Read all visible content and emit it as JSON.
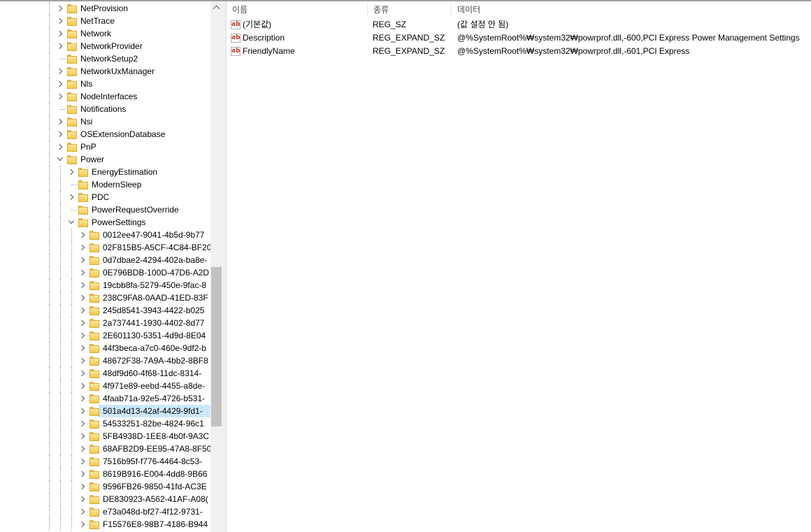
{
  "tree": {
    "items": [
      {
        "label": "NetProvision",
        "expander": "collapsed",
        "level": 0
      },
      {
        "label": "NetTrace",
        "expander": "collapsed",
        "level": 0
      },
      {
        "label": "Network",
        "expander": "collapsed",
        "level": 0
      },
      {
        "label": "NetworkProvider",
        "expander": "collapsed",
        "level": 0
      },
      {
        "label": "NetworkSetup2",
        "expander": "none",
        "level": 0
      },
      {
        "label": "NetworkUxManager",
        "expander": "collapsed",
        "level": 0
      },
      {
        "label": "Nls",
        "expander": "collapsed",
        "level": 0
      },
      {
        "label": "NodeInterfaces",
        "expander": "collapsed",
        "level": 0
      },
      {
        "label": "Notifications",
        "expander": "none",
        "level": 0
      },
      {
        "label": "Nsi",
        "expander": "collapsed",
        "level": 0
      },
      {
        "label": "OSExtensionDatabase",
        "expander": "collapsed",
        "level": 0
      },
      {
        "label": "PnP",
        "expander": "collapsed",
        "level": 0
      },
      {
        "label": "Power",
        "expander": "expanded",
        "level": 0
      },
      {
        "label": "EnergyEstimation",
        "expander": "collapsed",
        "level": 1
      },
      {
        "label": "ModernSleep",
        "expander": "none",
        "level": 1
      },
      {
        "label": "PDC",
        "expander": "collapsed",
        "level": 1
      },
      {
        "label": "PowerRequestOverride",
        "expander": "none",
        "level": 1
      },
      {
        "label": "PowerSettings",
        "expander": "expanded",
        "level": 1
      },
      {
        "label": "0012ee47-9041-4b5d-9b77",
        "expander": "collapsed",
        "level": 2
      },
      {
        "label": "02F815B5-A5CF-4C84-BF20",
        "expander": "collapsed",
        "level": 2
      },
      {
        "label": "0d7dbae2-4294-402a-ba8e-",
        "expander": "collapsed",
        "level": 2
      },
      {
        "label": "0E796BDB-100D-47D6-A2D",
        "expander": "collapsed",
        "level": 2
      },
      {
        "label": "19cbb8fa-5279-450e-9fac-8",
        "expander": "collapsed",
        "level": 2
      },
      {
        "label": "238C9FA8-0AAD-41ED-83F",
        "expander": "collapsed",
        "level": 2
      },
      {
        "label": "245d8541-3943-4422-b025",
        "expander": "collapsed",
        "level": 2
      },
      {
        "label": "2a737441-1930-4402-8d77",
        "expander": "collapsed",
        "level": 2
      },
      {
        "label": "2E601130-5351-4d9d-8E04",
        "expander": "collapsed",
        "level": 2
      },
      {
        "label": "44f3beca-a7c0-460e-9df2-b",
        "expander": "collapsed",
        "level": 2
      },
      {
        "label": "48672F38-7A9A-4bb2-8BF8",
        "expander": "collapsed",
        "level": 2
      },
      {
        "label": "48df9d60-4f68-11dc-8314-",
        "expander": "collapsed",
        "level": 2
      },
      {
        "label": "4f971e89-eebd-4455-a8de-",
        "expander": "collapsed",
        "level": 2
      },
      {
        "label": "4faab71a-92e5-4726-b531-",
        "expander": "collapsed",
        "level": 2
      },
      {
        "label": "501a4d13-42af-4429-9fd1-",
        "expander": "collapsed",
        "level": 2,
        "selected": true
      },
      {
        "label": "54533251-82be-4824-96c1",
        "expander": "collapsed",
        "level": 2
      },
      {
        "label": "5FB4938D-1EE8-4b0f-9A3C",
        "expander": "collapsed",
        "level": 2
      },
      {
        "label": "68AFB2D9-EE95-47A8-8F50",
        "expander": "collapsed",
        "level": 2
      },
      {
        "label": "7516b95f-f776-4464-8c53-",
        "expander": "collapsed",
        "level": 2
      },
      {
        "label": "8619B916-E004-4dd8-9B66",
        "expander": "collapsed",
        "level": 2
      },
      {
        "label": "9596FB26-9850-41fd-AC3E",
        "expander": "collapsed",
        "level": 2
      },
      {
        "label": "DE830923-A562-41AF-A08(",
        "expander": "collapsed",
        "level": 2
      },
      {
        "label": "e73a048d-bf27-4f12-9731-",
        "expander": "collapsed",
        "level": 2
      },
      {
        "label": "F15576E8-98B7-4186-B944",
        "expander": "collapsed",
        "level": 2
      }
    ]
  },
  "list": {
    "columns": {
      "name": "이름",
      "type": "종류",
      "data": "데이터"
    },
    "rows": [
      {
        "icon": "ab",
        "name": "(기본값)",
        "type": "REG_SZ",
        "data": "(값 설정 안 됨)"
      },
      {
        "icon": "ab",
        "name": "Description",
        "type": "REG_EXPAND_SZ",
        "data": "@%SystemRoot%₩system32₩powrprof.dll,-600,PCI Express Power Management Settings"
      },
      {
        "icon": "ab",
        "name": "FriendlyName",
        "type": "REG_EXPAND_SZ",
        "data": "@%SystemRoot%₩system32₩powrprof.dll,-601,PCI Express"
      }
    ]
  },
  "colors": {
    "selection": "#cce8ff",
    "folder": "#f5c94b",
    "string_icon": "#c0392b"
  }
}
